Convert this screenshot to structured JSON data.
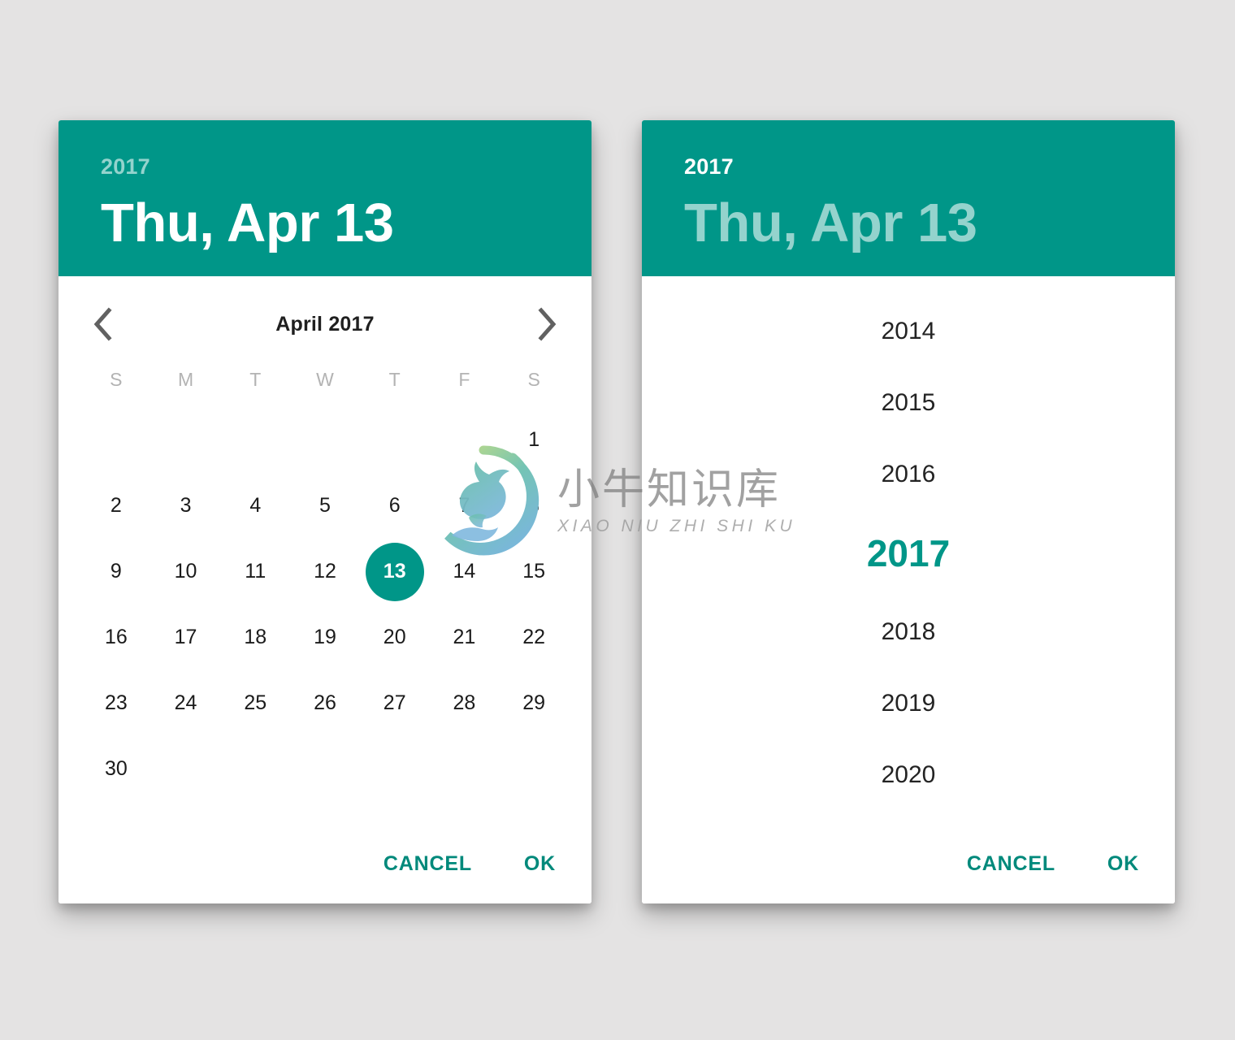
{
  "page": {
    "background_color": "#e4e3e3",
    "accent_color": "#009688",
    "action_color": "#00897b"
  },
  "watermark": {
    "logo_icon": "ox-head-in-circle-logo",
    "chinese": "小牛知识库",
    "pinyin": "XIAO NIU ZHI SHI KU"
  },
  "date_dialog": {
    "header": {
      "year": "2017",
      "date": "Thu, Apr 13",
      "year_state": "inactive",
      "date_state": "active"
    },
    "nav": {
      "prev_icon": "chevron-left-icon",
      "next_icon": "chevron-right-icon",
      "month_label": "April 2017"
    },
    "weekdays": [
      "S",
      "M",
      "T",
      "W",
      "T",
      "F",
      "S"
    ],
    "leading_blanks": 6,
    "days": [
      1,
      2,
      3,
      4,
      5,
      6,
      7,
      8,
      9,
      10,
      11,
      12,
      13,
      14,
      15,
      16,
      17,
      18,
      19,
      20,
      21,
      22,
      23,
      24,
      25,
      26,
      27,
      28,
      29,
      30
    ],
    "selected_day": 13,
    "actions": {
      "cancel_label": "CANCEL",
      "ok_label": "OK"
    }
  },
  "year_dialog": {
    "header": {
      "year": "2017",
      "date": "Thu, Apr 13",
      "year_state": "active",
      "date_state": "inactive"
    },
    "years": [
      "2014",
      "2015",
      "2016",
      "2017",
      "2018",
      "2019",
      "2020"
    ],
    "selected_year": "2017",
    "actions": {
      "cancel_label": "CANCEL",
      "ok_label": "OK"
    }
  }
}
